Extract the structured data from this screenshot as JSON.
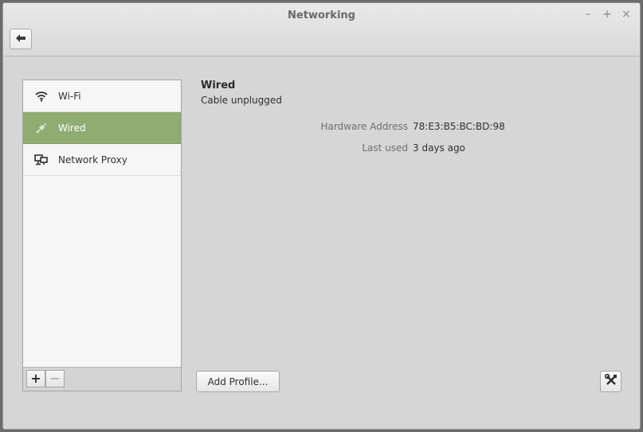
{
  "window": {
    "title": "Networking",
    "controls": {
      "minimize": "–",
      "maximize": "+",
      "close": "×"
    }
  },
  "toolbar": {
    "back_icon": "back-arrow-icon"
  },
  "sidebar": {
    "items": [
      {
        "label": "Wi-Fi",
        "icon": "wifi-icon",
        "selected": false
      },
      {
        "label": "Wired",
        "icon": "wired-plug-icon",
        "selected": true
      },
      {
        "label": "Network Proxy",
        "icon": "network-proxy-icon",
        "selected": false
      }
    ],
    "add_label": "+",
    "remove_label": "−"
  },
  "main": {
    "connection_name": "Wired",
    "connection_status": "Cable unplugged",
    "details": [
      {
        "label": "Hardware Address",
        "value": "78:E3:B5:BC:BD:98"
      },
      {
        "label": "Last used",
        "value": "3 days ago"
      }
    ],
    "add_profile_label": "Add Profile...",
    "settings_icon": "tools-icon"
  },
  "colors": {
    "selected_row": "#8fad72",
    "window_bg": "#d6d6d6"
  }
}
